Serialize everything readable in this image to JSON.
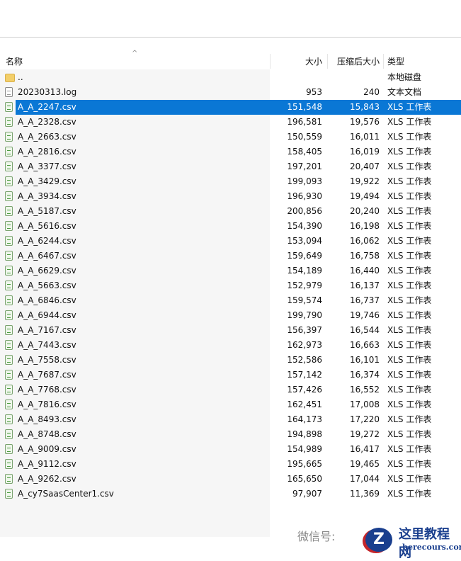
{
  "header": {
    "name": "名称",
    "size": "大小",
    "compressed": "压缩后大小",
    "type": "类型"
  },
  "rows": [
    {
      "name": "..",
      "size": "",
      "compressed": "",
      "type": "本地磁盘",
      "icon": "folder"
    },
    {
      "name": "20230313.log",
      "size": "953",
      "compressed": "240",
      "type": "文本文档",
      "icon": "log"
    },
    {
      "name": "A_A_2247.csv",
      "size": "151,548",
      "compressed": "15,843",
      "type": "XLS 工作表",
      "icon": "csv",
      "selected": true
    },
    {
      "name": "A_A_2328.csv",
      "size": "196,581",
      "compressed": "19,576",
      "type": "XLS 工作表",
      "icon": "csv"
    },
    {
      "name": "A_A_2663.csv",
      "size": "150,559",
      "compressed": "16,011",
      "type": "XLS 工作表",
      "icon": "csv"
    },
    {
      "name": "A_A_2816.csv",
      "size": "158,405",
      "compressed": "16,019",
      "type": "XLS 工作表",
      "icon": "csv"
    },
    {
      "name": "A_A_3377.csv",
      "size": "197,201",
      "compressed": "20,407",
      "type": "XLS 工作表",
      "icon": "csv"
    },
    {
      "name": "A_A_3429.csv",
      "size": "199,093",
      "compressed": "19,922",
      "type": "XLS 工作表",
      "icon": "csv"
    },
    {
      "name": "A_A_3934.csv",
      "size": "196,930",
      "compressed": "19,494",
      "type": "XLS 工作表",
      "icon": "csv"
    },
    {
      "name": "A_A_5187.csv",
      "size": "200,856",
      "compressed": "20,240",
      "type": "XLS 工作表",
      "icon": "csv"
    },
    {
      "name": "A_A_5616.csv",
      "size": "154,390",
      "compressed": "16,198",
      "type": "XLS 工作表",
      "icon": "csv"
    },
    {
      "name": "A_A_6244.csv",
      "size": "153,094",
      "compressed": "16,062",
      "type": "XLS 工作表",
      "icon": "csv"
    },
    {
      "name": "A_A_6467.csv",
      "size": "159,649",
      "compressed": "16,758",
      "type": "XLS 工作表",
      "icon": "csv"
    },
    {
      "name": "A_A_6629.csv",
      "size": "154,189",
      "compressed": "16,440",
      "type": "XLS 工作表",
      "icon": "csv"
    },
    {
      "name": "A_A_5663.csv",
      "size": "152,979",
      "compressed": "16,137",
      "type": "XLS 工作表",
      "icon": "csv"
    },
    {
      "name": "A_A_6846.csv",
      "size": "159,574",
      "compressed": "16,737",
      "type": "XLS 工作表",
      "icon": "csv"
    },
    {
      "name": "A_A_6944.csv",
      "size": "199,790",
      "compressed": "19,746",
      "type": "XLS 工作表",
      "icon": "csv"
    },
    {
      "name": "A_A_7167.csv",
      "size": "156,397",
      "compressed": "16,544",
      "type": "XLS 工作表",
      "icon": "csv"
    },
    {
      "name": "A_A_7443.csv",
      "size": "162,973",
      "compressed": "16,663",
      "type": "XLS 工作表",
      "icon": "csv"
    },
    {
      "name": "A_A_7558.csv",
      "size": "152,586",
      "compressed": "16,101",
      "type": "XLS 工作表",
      "icon": "csv"
    },
    {
      "name": "A_A_7687.csv",
      "size": "157,142",
      "compressed": "16,374",
      "type": "XLS 工作表",
      "icon": "csv"
    },
    {
      "name": "A_A_7768.csv",
      "size": "157,426",
      "compressed": "16,552",
      "type": "XLS 工作表",
      "icon": "csv"
    },
    {
      "name": "A_A_7816.csv",
      "size": "162,451",
      "compressed": "17,008",
      "type": "XLS 工作表",
      "icon": "csv"
    },
    {
      "name": "A_A_8493.csv",
      "size": "164,173",
      "compressed": "17,220",
      "type": "XLS 工作表",
      "icon": "csv"
    },
    {
      "name": "A_A_8748.csv",
      "size": "194,898",
      "compressed": "19,272",
      "type": "XLS 工作表",
      "icon": "csv"
    },
    {
      "name": "A_A_9009.csv",
      "size": "154,989",
      "compressed": "16,417",
      "type": "XLS 工作表",
      "icon": "csv"
    },
    {
      "name": "A_A_9112.csv",
      "size": "195,665",
      "compressed": "19,465",
      "type": "XLS 工作表",
      "icon": "csv"
    },
    {
      "name": "A_A_9262.csv",
      "size": "165,650",
      "compressed": "17,044",
      "type": "XLS 工作表",
      "icon": "csv"
    },
    {
      "name": "A_cy7SaasCenter1.csv",
      "size": "97,907",
      "compressed": "11,369",
      "type": "XLS 工作表",
      "icon": "csv"
    }
  ],
  "watermark": {
    "wechat": "微信号:",
    "brand": "这里教程网",
    "site": "herecours.com",
    "logo_letter": "Z"
  }
}
